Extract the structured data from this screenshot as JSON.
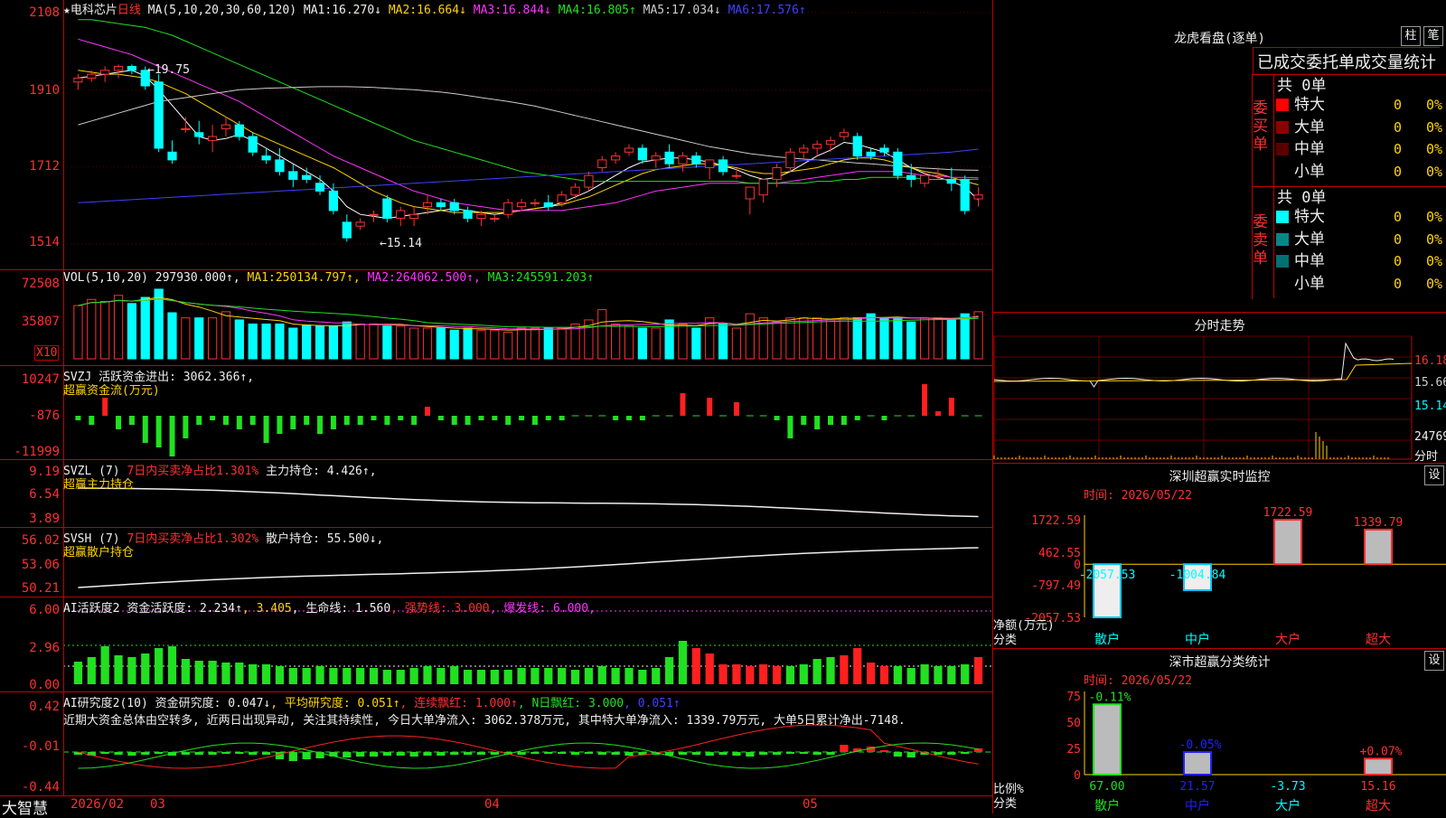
{
  "main": {
    "title": "★电科芯片",
    "period": "日线",
    "ma_label": "MA(5,10,20,30,60,120)",
    "ma": [
      {
        "name": "MA1",
        "value": "16.270↓",
        "color": "#ffffff"
      },
      {
        "name": "MA2",
        "value": "16.664↓",
        "color": "#ffd400"
      },
      {
        "name": "MA3",
        "value": "16.844↓",
        "color": "#ff33ff"
      },
      {
        "name": "MA4",
        "value": "16.805↑",
        "color": "#21e021"
      },
      {
        "name": "MA5",
        "value": "17.034↓",
        "color": "#cccccc"
      },
      {
        "name": "MA6",
        "value": "17.576↑",
        "color": "#4040ff"
      }
    ],
    "y_ticks": [
      "2108",
      "1910",
      "1712",
      "1514"
    ],
    "hi_note": "←19.75",
    "lo_note": "←15.14"
  },
  "vol": {
    "label": "VOL(5,10,20)",
    "value": "297930.000↑",
    "ma": [
      {
        "name": "MA1",
        "value": "250134.797↑",
        "color": "#ffd400"
      },
      {
        "name": "MA2",
        "value": "264062.500↑",
        "color": "#ff33ff"
      },
      {
        "name": "MA3",
        "value": "245591.203↑",
        "color": "#21e021"
      }
    ],
    "y_ticks": [
      "72508",
      "35807"
    ],
    "unit": "X10"
  },
  "svzj": {
    "label": "SVZJ",
    "desc": "活跃资金进出: 3062.366↑,",
    "sub": "超赢资金流(万元)",
    "y_ticks": [
      "10247",
      "-876",
      "-11999"
    ]
  },
  "svzl": {
    "label": "SVZL (7)",
    "desc1": "7日内买卖净占比1.301%",
    "desc2": "主力持仓: 4.426↑,",
    "sub": "超赢主力持仓",
    "y_ticks": [
      "9.19",
      "6.54",
      "3.89"
    ]
  },
  "svsh": {
    "label": "SVSH (7)",
    "desc1": "7日内买卖净占比1.302%",
    "desc2": "散户持仓: 55.500↓,",
    "sub": "超赢散户持仓",
    "y_ticks": [
      "56.02",
      "53.06",
      "50.21"
    ]
  },
  "ai1": {
    "label": "AI活跃度2",
    "desc1": "资金活跃度: 2.234↑",
    "desc2": ", 3.405",
    "desc3": ", 生命线: 1.560",
    "desc4": ", 强势线: 3.000",
    "desc5": ", 爆发线: 6.000,",
    "y_ticks": [
      "6.00",
      "2.96",
      "0.00"
    ]
  },
  "ai2": {
    "label": "AI研究度2(10)",
    "desc1": "资金研究度: 0.047↓",
    "desc2": ", 平均研究度: 0.051↑",
    "desc3": ", 连续飘红: 1.000↑",
    "desc4": ", N日飘红: 3.000",
    "desc5": ", 0.051↑",
    "note": "近期大资金总体由空转多, 近两日出现异动, 关注其持续性, 今日大单净流入: 3062.378万元, 其中特大单净流入: 1339.79万元, 大单5日累计净出-7148.",
    "y_ticks": [
      "0.42",
      "-0.01",
      "-0.44"
    ]
  },
  "xaxis": {
    "brand": "大智慧",
    "labels": [
      "2026/02",
      "03",
      "04",
      "05"
    ]
  },
  "right": {
    "dragon": {
      "title": "龙虎看盘(逐单)",
      "btn1": "柱",
      "btn2": "笔",
      "subtitle": "已成交委托单成交量统计",
      "buy_label": "委买单",
      "sell_label": "委卖单",
      "buy_total": "共 0单",
      "sell_total": "共 0单",
      "buy_rows": [
        {
          "name": "特大",
          "count": "0",
          "pct": "0%",
          "color": "#ff0000"
        },
        {
          "name": "大单",
          "count": "0",
          "pct": "0%",
          "color": "#8b0000"
        },
        {
          "name": "中单",
          "count": "0",
          "pct": "0%",
          "color": "#5a0000"
        },
        {
          "name": "小单",
          "count": "0",
          "pct": "0%",
          "color": "#000000"
        }
      ],
      "sell_rows": [
        {
          "name": "特大",
          "count": "0",
          "pct": "0%",
          "color": "#00ffff"
        },
        {
          "name": "大单",
          "count": "0",
          "pct": "0%",
          "color": "#008888"
        },
        {
          "name": "中单",
          "count": "0",
          "pct": "0%",
          "color": "#007070"
        },
        {
          "name": "小单",
          "count": "0",
          "pct": "0%",
          "color": "#000000"
        }
      ]
    },
    "intraday": {
      "title": "分时走势",
      "y_ticks": [
        "16.18",
        "15.66",
        "15.14"
      ],
      "vol_tick": "24769",
      "vol_unit": "分时"
    },
    "monitor": {
      "title": "深圳超赢实时监控",
      "btn": "设",
      "time": "时间: 2026/05/22",
      "y_ticks": [
        "1722.59",
        "462.55",
        "0",
        "-797.49",
        "-2057.53"
      ],
      "y_title": "净额(万元)",
      "x_title": "分类",
      "bars": [
        {
          "cat": "散户",
          "value": -2057.53,
          "label": "-2057.53"
        },
        {
          "cat": "中户",
          "value": -1004.84,
          "label": "-1004.84"
        },
        {
          "cat": "大户",
          "value": 1722.59,
          "label": "1722.59"
        },
        {
          "cat": "超大",
          "value": 1339.79,
          "label": "1339.79"
        }
      ]
    },
    "stats": {
      "title": "深市超赢分类统计",
      "btn": "设",
      "time": "时间: 2026/05/22",
      "y_ticks": [
        "75",
        "50",
        "25",
        "0"
      ],
      "y_title": "比例%",
      "x_title": "分类",
      "bars": [
        {
          "cat": "散户",
          "value": 67.0,
          "label": "67.00",
          "chg": "-0.11%"
        },
        {
          "cat": "中户",
          "value": 21.57,
          "label": "21.57",
          "chg": "-0.05%"
        },
        {
          "cat": "大户",
          "value": -3.73,
          "label": "-3.73",
          "chg": ""
        },
        {
          "cat": "超大",
          "value": 15.16,
          "label": "15.16",
          "chg": "+0.07%"
        }
      ]
    }
  },
  "chart_data": {
    "type": "candlestick",
    "title": "电科芯片 日线",
    "ylim": [
      15.14,
      21.08
    ],
    "ohlc": [
      [
        19.3,
        19.5,
        19.1,
        19.4
      ],
      [
        19.4,
        19.6,
        19.3,
        19.5
      ],
      [
        19.5,
        19.7,
        19.3,
        19.6
      ],
      [
        19.6,
        19.75,
        19.4,
        19.7
      ],
      [
        19.7,
        19.75,
        19.5,
        19.6
      ],
      [
        19.6,
        19.7,
        19.1,
        19.2
      ],
      [
        19.3,
        19.5,
        17.5,
        17.6
      ],
      [
        17.5,
        17.8,
        17.2,
        17.3
      ],
      [
        18.1,
        18.4,
        18.0,
        18.1
      ],
      [
        18.0,
        18.3,
        17.7,
        17.9
      ],
      [
        17.8,
        18.2,
        17.5,
        17.9
      ],
      [
        18.1,
        18.4,
        17.9,
        18.2
      ],
      [
        18.2,
        18.3,
        17.8,
        17.9
      ],
      [
        17.9,
        18.0,
        17.4,
        17.5
      ],
      [
        17.4,
        17.6,
        17.2,
        17.3
      ],
      [
        17.3,
        17.6,
        16.9,
        17.0
      ],
      [
        17.0,
        17.2,
        16.6,
        16.8
      ],
      [
        16.9,
        17.1,
        16.7,
        16.8
      ],
      [
        16.7,
        16.9,
        16.4,
        16.5
      ],
      [
        16.5,
        16.7,
        15.9,
        16.0
      ],
      [
        15.7,
        15.9,
        15.2,
        15.3
      ],
      [
        15.6,
        15.8,
        15.5,
        15.7
      ],
      [
        15.9,
        16.0,
        15.7,
        15.9
      ],
      [
        16.3,
        16.4,
        15.7,
        15.8
      ],
      [
        15.8,
        16.1,
        15.6,
        16.0
      ],
      [
        15.8,
        16.1,
        15.6,
        15.9
      ],
      [
        16.1,
        16.4,
        15.9,
        16.2
      ],
      [
        16.2,
        16.3,
        16.0,
        16.1
      ],
      [
        16.2,
        16.3,
        15.9,
        16.0
      ],
      [
        16.0,
        16.1,
        15.7,
        15.8
      ],
      [
        15.8,
        16.0,
        15.6,
        15.9
      ],
      [
        15.8,
        15.9,
        15.7,
        15.8
      ],
      [
        15.9,
        16.3,
        15.8,
        16.2
      ],
      [
        16.1,
        16.3,
        16.0,
        16.2
      ],
      [
        16.2,
        16.3,
        16.1,
        16.2
      ],
      [
        16.2,
        16.4,
        16.0,
        16.1
      ],
      [
        16.2,
        16.5,
        16.1,
        16.4
      ],
      [
        16.4,
        16.7,
        16.3,
        16.6
      ],
      [
        16.6,
        17.0,
        16.5,
        16.9
      ],
      [
        17.1,
        17.4,
        17.0,
        17.3
      ],
      [
        17.3,
        17.5,
        17.2,
        17.4
      ],
      [
        17.5,
        17.7,
        17.4,
        17.6
      ],
      [
        17.6,
        17.7,
        17.2,
        17.3
      ],
      [
        17.3,
        17.5,
        17.1,
        17.4
      ],
      [
        17.5,
        17.7,
        17.1,
        17.2
      ],
      [
        17.2,
        17.5,
        17.0,
        17.4
      ],
      [
        17.4,
        17.5,
        17.1,
        17.2
      ],
      [
        17.1,
        17.3,
        16.8,
        17.3
      ],
      [
        17.3,
        17.4,
        16.9,
        17.0
      ],
      [
        16.9,
        17.1,
        16.8,
        16.9
      ],
      [
        16.3,
        16.6,
        15.9,
        16.6
      ],
      [
        16.4,
        16.8,
        16.2,
        16.8
      ],
      [
        16.8,
        17.2,
        16.6,
        17.1
      ],
      [
        17.1,
        17.6,
        17.0,
        17.5
      ],
      [
        17.5,
        17.7,
        17.3,
        17.6
      ],
      [
        17.6,
        17.8,
        17.4,
        17.7
      ],
      [
        17.7,
        17.9,
        17.5,
        17.8
      ],
      [
        17.9,
        18.1,
        17.8,
        18.0
      ],
      [
        17.9,
        18.0,
        17.3,
        17.4
      ],
      [
        17.5,
        17.6,
        17.3,
        17.4
      ],
      [
        17.6,
        17.7,
        17.4,
        17.5
      ],
      [
        17.5,
        17.6,
        16.8,
        16.9
      ],
      [
        16.9,
        17.2,
        16.6,
        16.8
      ],
      [
        16.7,
        17.0,
        16.6,
        16.9
      ],
      [
        16.9,
        17.1,
        16.8,
        16.9
      ],
      [
        16.8,
        17.1,
        16.5,
        16.7
      ],
      [
        16.8,
        16.9,
        15.9,
        16.0
      ],
      [
        16.3,
        16.6,
        16.1,
        16.4
      ]
    ],
    "series": [
      {
        "name": "MA1",
        "values": [
          19.4,
          19.45,
          19.5,
          19.55,
          19.6,
          19.45,
          19.1,
          18.7,
          18.3,
          17.9,
          17.8,
          17.85,
          17.95,
          17.8,
          17.6,
          17.4,
          17.2,
          17.0,
          16.8,
          16.5,
          16.1,
          15.9,
          15.85,
          15.8,
          15.85,
          15.9,
          15.95,
          16.0,
          16.05,
          16.0,
          15.95,
          15.9,
          15.95,
          16.0,
          16.05,
          16.1,
          16.2,
          16.35,
          16.5,
          16.7,
          16.9,
          17.1,
          17.25,
          17.3,
          17.35,
          17.35,
          17.3,
          17.25,
          17.15,
          17.05,
          16.9,
          16.8,
          16.85,
          17.0,
          17.2,
          17.4,
          17.55,
          17.75,
          17.7,
          17.6,
          17.5,
          17.3,
          17.1,
          16.95,
          16.85,
          16.75,
          16.6,
          16.27
        ]
      },
      {
        "name": "MA2",
        "values": [
          19.6,
          19.55,
          19.5,
          19.5,
          19.45,
          19.4,
          19.3,
          19.15,
          19.0,
          18.8,
          18.6,
          18.4,
          18.2,
          18.0,
          17.85,
          17.7,
          17.55,
          17.4,
          17.25,
          17.1,
          16.9,
          16.7,
          16.5,
          16.35,
          16.2,
          16.1,
          16.05,
          16.0,
          15.95,
          15.95,
          15.95,
          15.95,
          15.95,
          16.0,
          16.05,
          16.1,
          16.15,
          16.25,
          16.35,
          16.5,
          16.65,
          16.8,
          16.95,
          17.05,
          17.1,
          17.15,
          17.2,
          17.2,
          17.15,
          17.1,
          17.0,
          16.95,
          16.95,
          17.0,
          17.05,
          17.1,
          17.2,
          17.3,
          17.35,
          17.35,
          17.3,
          17.2,
          17.1,
          17.0,
          16.95,
          16.85,
          16.75,
          16.66
        ]
      },
      {
        "name": "MA3",
        "values": [
          20.4,
          20.3,
          20.2,
          20.1,
          20.0,
          19.85,
          19.7,
          19.55,
          19.4,
          19.25,
          19.1,
          18.95,
          18.8,
          18.6,
          18.4,
          18.2,
          18.0,
          17.8,
          17.6,
          17.4,
          17.25,
          17.1,
          16.95,
          16.8,
          16.65,
          16.5,
          16.4,
          16.3,
          16.2,
          16.15,
          16.1,
          16.05,
          16.0,
          16.0,
          16.0,
          16.0,
          16.0,
          16.05,
          16.1,
          16.15,
          16.2,
          16.3,
          16.4,
          16.5,
          16.55,
          16.6,
          16.65,
          16.7,
          16.7,
          16.7,
          16.7,
          16.7,
          16.7,
          16.75,
          16.8,
          16.85,
          16.9,
          16.95,
          17.0,
          17.0,
          17.0,
          17.0,
          16.95,
          16.9,
          16.9,
          16.85,
          16.85,
          16.84
        ]
      },
      {
        "name": "MA4",
        "values": [
          20.9,
          20.9,
          20.85,
          20.8,
          20.75,
          20.7,
          20.6,
          20.5,
          20.35,
          20.2,
          20.05,
          19.9,
          19.75,
          19.6,
          19.45,
          19.3,
          19.15,
          19.0,
          18.85,
          18.7,
          18.55,
          18.4,
          18.25,
          18.1,
          17.95,
          17.8,
          17.7,
          17.6,
          17.5,
          17.4,
          17.3,
          17.2,
          17.1,
          17.0,
          16.95,
          16.9,
          16.85,
          16.8,
          16.75,
          16.75,
          16.75,
          16.75,
          16.75,
          16.75,
          16.75,
          16.75,
          16.75,
          16.75,
          16.75,
          16.75,
          16.7,
          16.7,
          16.7,
          16.7,
          16.7,
          16.75,
          16.75,
          16.8,
          16.8,
          16.85,
          16.85,
          16.85,
          16.85,
          16.8,
          16.8,
          16.8,
          16.8,
          16.805
        ]
      },
      {
        "name": "MA5",
        "values": [
          18.2,
          18.3,
          18.4,
          18.5,
          18.6,
          18.7,
          18.8,
          18.85,
          18.9,
          18.95,
          19.0,
          19.05,
          19.1,
          19.12,
          19.14,
          19.15,
          19.16,
          19.17,
          19.18,
          19.18,
          19.18,
          19.17,
          19.16,
          19.14,
          19.12,
          19.1,
          19.07,
          19.04,
          19.0,
          18.95,
          18.9,
          18.85,
          18.8,
          18.74,
          18.68,
          18.6,
          18.52,
          18.44,
          18.36,
          18.28,
          18.2,
          18.12,
          18.04,
          17.96,
          17.88,
          17.8,
          17.72,
          17.64,
          17.58,
          17.52,
          17.46,
          17.42,
          17.38,
          17.35,
          17.32,
          17.3,
          17.27,
          17.25,
          17.22,
          17.2,
          17.17,
          17.14,
          17.11,
          17.09,
          17.07,
          17.05,
          17.04,
          17.034
        ]
      },
      {
        "name": "MA6",
        "values": [
          16.2,
          16.22,
          16.24,
          16.26,
          16.28,
          16.3,
          16.32,
          16.34,
          16.36,
          16.38,
          16.4,
          16.42,
          16.44,
          16.46,
          16.48,
          16.5,
          16.52,
          16.54,
          16.56,
          16.58,
          16.6,
          16.62,
          16.64,
          16.66,
          16.68,
          16.7,
          16.72,
          16.74,
          16.76,
          16.78,
          16.8,
          16.82,
          16.84,
          16.86,
          16.88,
          16.9,
          16.92,
          16.94,
          16.96,
          16.98,
          17.0,
          17.02,
          17.04,
          17.06,
          17.08,
          17.1,
          17.12,
          17.14,
          17.16,
          17.18,
          17.2,
          17.22,
          17.24,
          17.26,
          17.28,
          17.3,
          17.32,
          17.34,
          17.36,
          17.38,
          17.4,
          17.42,
          17.44,
          17.46,
          17.48,
          17.5,
          17.54,
          17.576
        ]
      }
    ],
    "volume": [
      52,
      58,
      56,
      62,
      54,
      60,
      68,
      45,
      40,
      40,
      40,
      46,
      38,
      34,
      34,
      34,
      30,
      33,
      32,
      32,
      36,
      34,
      34,
      32,
      32,
      30,
      30,
      30,
      28,
      30,
      28,
      28,
      26,
      30,
      30,
      30,
      30,
      34,
      38,
      48,
      34,
      32,
      30,
      30,
      38,
      34,
      30,
      40,
      34,
      30,
      44,
      40,
      36,
      40,
      40,
      40,
      38,
      40,
      40,
      44,
      40,
      40,
      36,
      40,
      40,
      38,
      44,
      46
    ],
    "svzj": [
      -1,
      -2,
      4,
      -3,
      -2,
      -6,
      -7,
      -9,
      -5,
      -2,
      -1,
      -2,
      -3,
      -2,
      -6,
      -4,
      -3,
      -2,
      -4,
      -3,
      -2,
      -2,
      -1,
      -2,
      -1,
      -2,
      2,
      -1,
      -2,
      -2,
      -1,
      -1,
      -2,
      -1,
      -2,
      -1,
      -1,
      0,
      0,
      0,
      -1,
      -1,
      -1,
      0,
      0,
      5,
      0,
      4,
      0,
      3,
      0,
      0,
      -1,
      -5,
      -2,
      -3,
      -2,
      -2,
      -1,
      0,
      -1,
      0,
      0,
      7,
      1,
      4,
      0,
      0,
      0,
      -9,
      -6,
      -3,
      -4,
      -5,
      -1,
      -2,
      -1,
      -2,
      0,
      -6,
      0,
      0,
      3
    ]
  }
}
